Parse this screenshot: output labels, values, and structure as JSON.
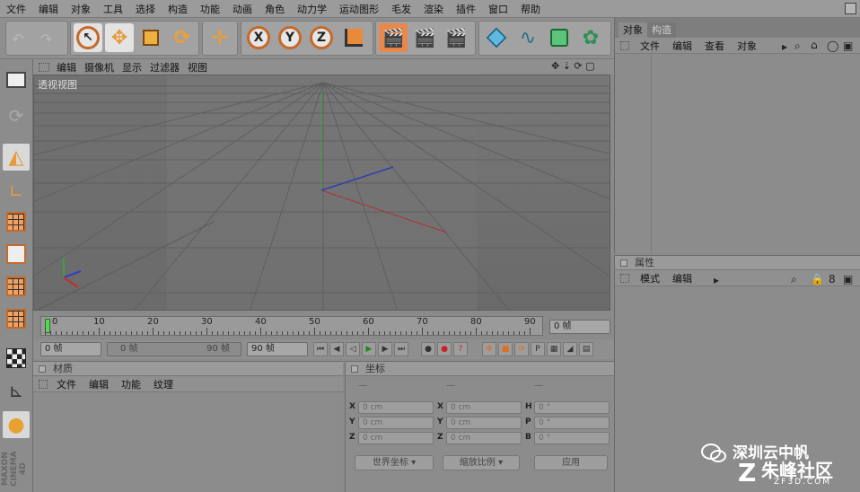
{
  "menubar": {
    "items": [
      "文件",
      "编辑",
      "对象",
      "工具",
      "选择",
      "构造",
      "功能",
      "动画",
      "角色",
      "动力学",
      "运动图形",
      "毛发",
      "渲染",
      "插件",
      "窗口",
      "帮助"
    ]
  },
  "toolbar": {
    "axis_x": "X",
    "axis_y": "Y",
    "axis_z": "Z"
  },
  "viewport": {
    "menu": [
      "编辑",
      "摄像机",
      "显示",
      "过滤器",
      "视图"
    ],
    "label": "透视视图"
  },
  "timeline": {
    "ticks": [
      "0",
      "10",
      "20",
      "30",
      "40",
      "50",
      "60",
      "70",
      "80",
      "90"
    ],
    "current_frame": "0 帧"
  },
  "transport": {
    "start_frame": "0 帧",
    "range_start": "0 帧",
    "range_end": "90 帧",
    "end_frame": "90 帧"
  },
  "material_panel": {
    "title": "材质",
    "menu": [
      "文件",
      "编辑",
      "功能",
      "纹理"
    ]
  },
  "coord_panel": {
    "title": "坐标",
    "headers": [
      "—",
      "—",
      "—"
    ],
    "labels": [
      "X",
      "Y",
      "Z",
      "X",
      "Y",
      "Z",
      "H",
      "P",
      "B"
    ],
    "values": [
      "0 cm",
      "0 cm",
      "0 cm",
      "0 cm",
      "0 cm",
      "0 cm",
      "0 °",
      "0 °",
      "0 °"
    ],
    "world_dropdown": "世界坐标",
    "scale_dropdown": "缩放比例",
    "apply_button": "应用"
  },
  "object_panel": {
    "tabs": [
      "对象",
      "构造"
    ],
    "menu": [
      "文件",
      "编辑",
      "查看",
      "对象"
    ]
  },
  "attr_panel": {
    "title": "属性",
    "menu": [
      "模式",
      "编辑"
    ]
  },
  "branding": {
    "maxon": "MAXON CINEMA 4D"
  },
  "watermark": {
    "line1": "深圳云中帆",
    "line2": "朱峰社区",
    "line3": "ZF3D.COM"
  },
  "colors": {
    "accent": "#e8884a",
    "axis_ring": "#c46a2a",
    "viewport_bg": "#707070"
  }
}
